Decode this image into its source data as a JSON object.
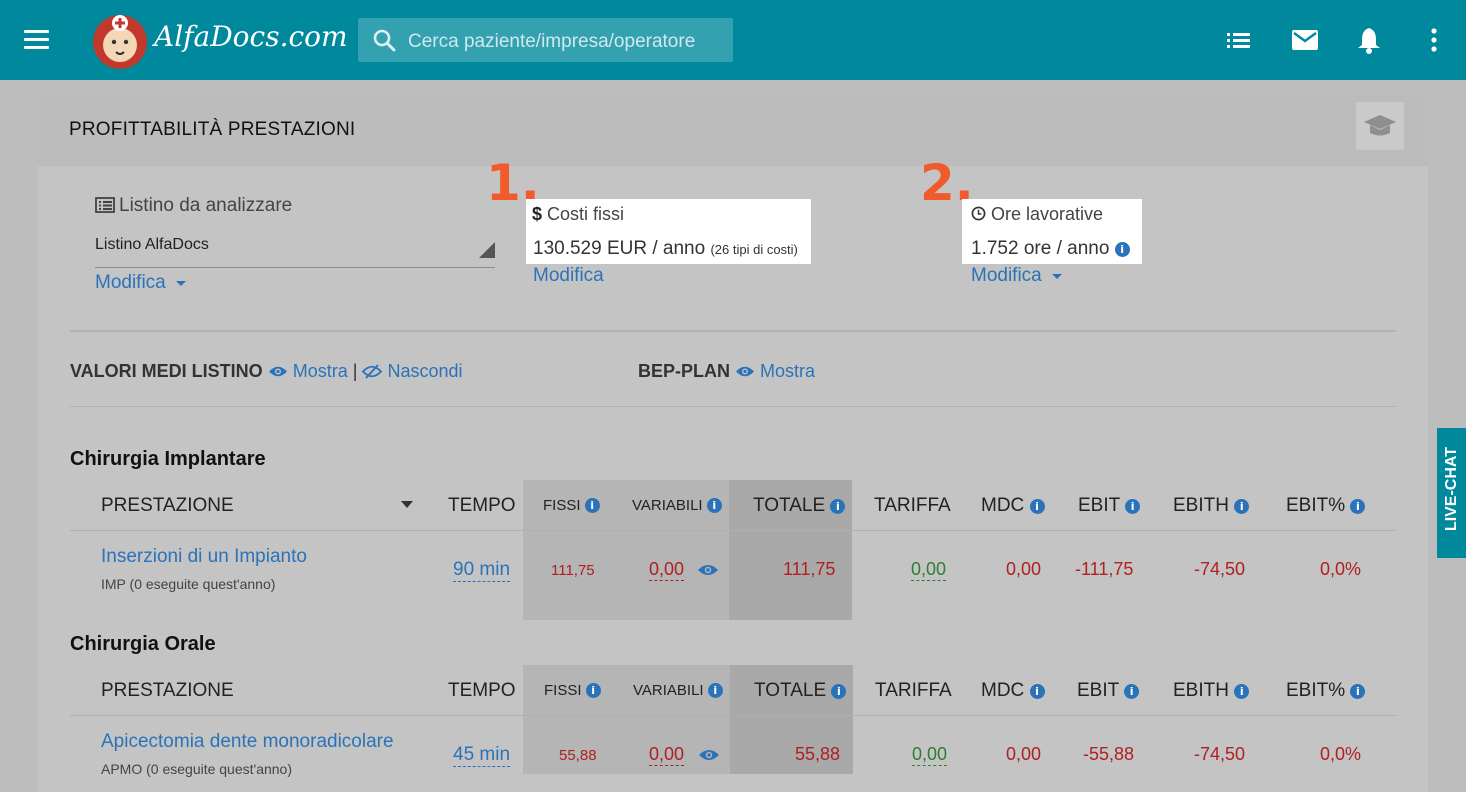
{
  "topbar": {
    "logo_text": "AlfaDocs.com",
    "search_placeholder": "Cerca paziente/impresa/operatore"
  },
  "page": {
    "title": "PROFITTABILITÀ PRESTAZIONI"
  },
  "listino": {
    "label": "Listino da analizzare",
    "value": "Listino AlfaDocs",
    "edit_label": "Modifica"
  },
  "costi_fissi": {
    "badge": "1.",
    "icon_glyph": "$",
    "label": "Costi fissi",
    "value": "130.529 EUR / anno",
    "note": "(26 tipi di costi)",
    "edit_label": "Modifica"
  },
  "ore_lavorative": {
    "badge": "2.",
    "label": "Ore lavorative",
    "value": "1.752 ore / anno",
    "edit_label": "Modifica"
  },
  "valori_medi": {
    "label": "VALORI MEDI LISTINO",
    "show": "Mostra",
    "separator": "|",
    "hide": "Nascondi"
  },
  "bep_plan": {
    "label": "BEP-PLAN",
    "show": "Mostra"
  },
  "table_headers": {
    "prestazione": "PRESTAZIONE",
    "tempo": "TEMPO",
    "fissi": "FISSI",
    "variabili": "VARIABILI",
    "totale": "TOTALE",
    "tariffa": "TARIFFA",
    "mdc": "MDC",
    "ebit": "EBIT",
    "ebith": "EBITH",
    "ebit_pct": "EBIT%"
  },
  "sections": [
    {
      "title": "Chirurgia Implantare",
      "rows": [
        {
          "name": "Inserzioni di un Impianto",
          "code": "IMP (0 eseguite quest'anno)",
          "tempo": "90 min",
          "fissi": "111,75",
          "variabili": "0,00",
          "totale": "111,75",
          "tariffa": "0,00",
          "mdc": "0,00",
          "ebit": "-111,75",
          "ebith": "-74,50",
          "ebit_pct": "0,0%"
        }
      ]
    },
    {
      "title": "Chirurgia Orale",
      "rows": [
        {
          "name": "Apicectomia dente monoradicolare",
          "code": "APMO (0 eseguite quest'anno)",
          "tempo": "45 min",
          "fissi": "55,88",
          "variabili": "0,00",
          "totale": "55,88",
          "tariffa": "0,00",
          "mdc": "0,00",
          "ebit": "-55,88",
          "ebith": "-74,50",
          "ebit_pct": "0,0%"
        }
      ]
    }
  ],
  "livechat": {
    "label": "LIVE-CHAT"
  },
  "colors": {
    "topbar": "#00899c",
    "link": "#2b73b9",
    "annotation": "#f15a2b",
    "negative": "#b02020",
    "positive": "#2e7d32"
  }
}
